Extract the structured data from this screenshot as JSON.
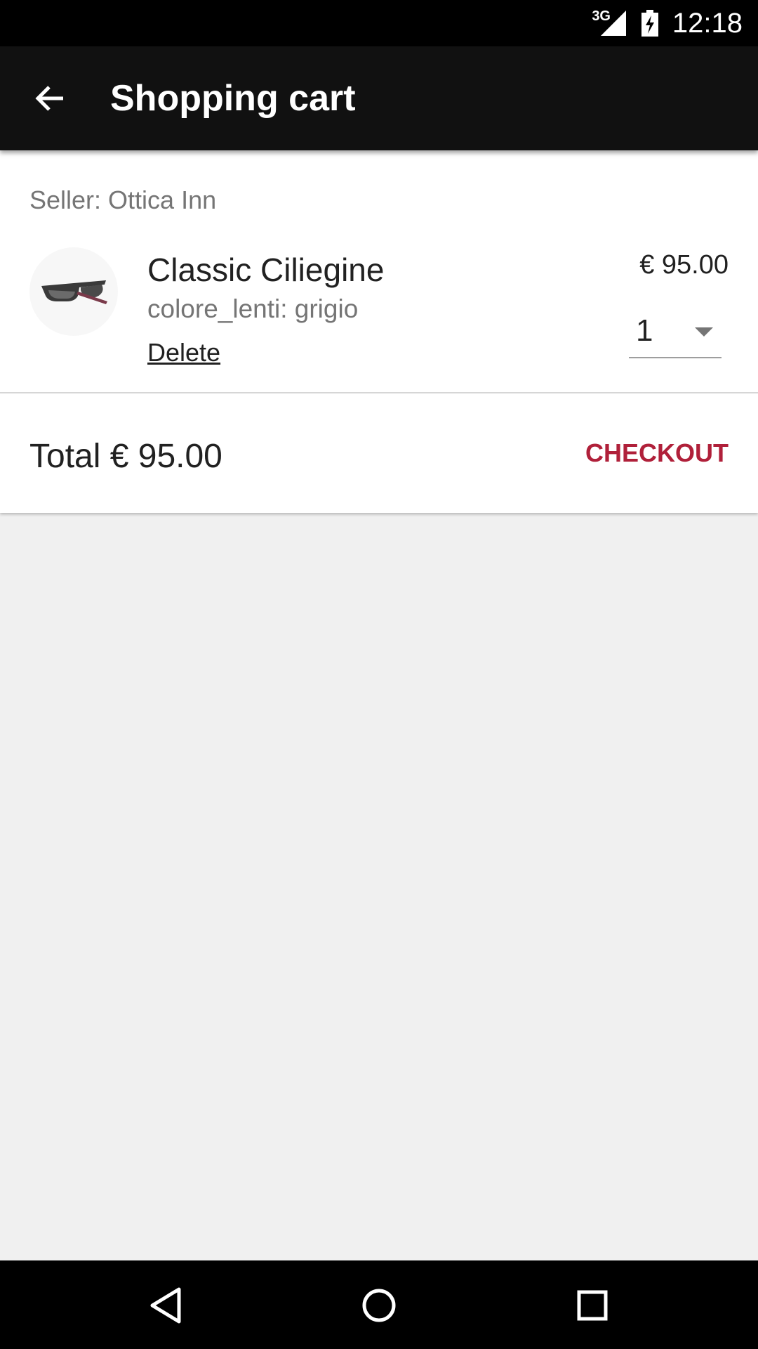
{
  "status_bar": {
    "network": "3G",
    "time": "12:18"
  },
  "app_bar": {
    "title": "Shopping cart",
    "back_icon": "arrow-back-icon"
  },
  "cart": {
    "seller": "Seller: Ottica Inn",
    "item": {
      "name": "Classic Ciliegine",
      "variant": "colore_lenti: grigio",
      "delete_label": "Delete",
      "price": "€ 95.00",
      "quantity": "1",
      "image_icon": "sunglasses-icon"
    },
    "total": "Total € 95.00",
    "checkout_label": "CHECKOUT"
  },
  "nav_bar": {
    "back": "nav-back-icon",
    "home": "nav-home-icon",
    "recents": "nav-recents-icon"
  },
  "colors": {
    "app_bar": "#111111",
    "accent": "#b0203a",
    "background": "#f0f0f0"
  }
}
